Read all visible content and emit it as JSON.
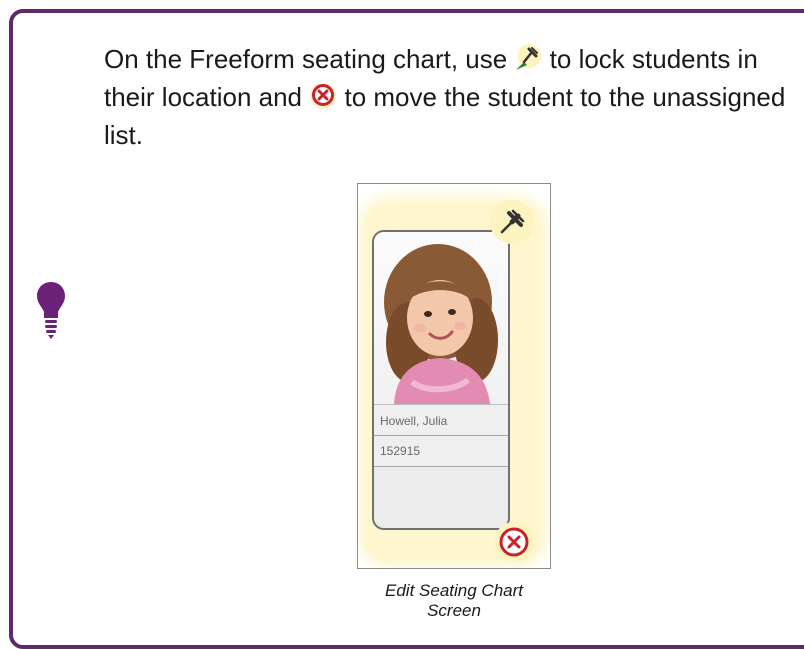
{
  "tip": {
    "text_part1": "On the Freeform seating chart, use",
    "text_part2": " to lock students in their location and",
    "text_part3": " to move the student to the unassigned list.",
    "pin_icon": "pushpin-icon",
    "remove_icon": "remove-circle-icon"
  },
  "bulb_icon": "lightbulb-icon",
  "student_card": {
    "name": "Howell, Julia",
    "id": "152915"
  },
  "caption": "Edit Seating Chart Screen",
  "colors": {
    "border": "#5e2a6a",
    "bulb": "#6b2177",
    "highlight": "#fdf6cf",
    "remove_red": "#c8232c"
  }
}
